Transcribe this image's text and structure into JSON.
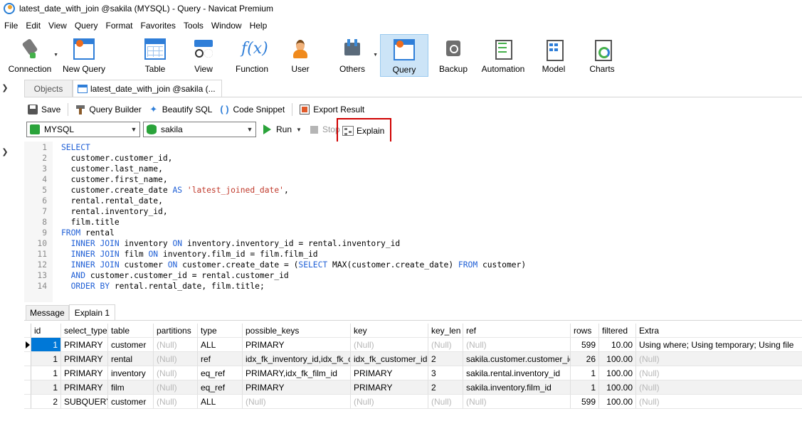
{
  "window": {
    "title": "latest_date_with_join @sakila (MYSQL) - Query - Navicat Premium"
  },
  "menu": [
    "File",
    "Edit",
    "View",
    "Query",
    "Format",
    "Favorites",
    "Tools",
    "Window",
    "Help"
  ],
  "toolbar": {
    "connection": "Connection",
    "new_query": "New Query",
    "table": "Table",
    "view": "View",
    "function": "Function",
    "function_glyph": "f(x)",
    "user": "User",
    "others": "Others",
    "query": "Query",
    "backup": "Backup",
    "automation": "Automation",
    "model": "Model",
    "charts": "Charts"
  },
  "tabs": {
    "objects": "Objects",
    "query_tab": "latest_date_with_join @sakila (..."
  },
  "query_toolbar": {
    "save": "Save",
    "query_builder": "Query Builder",
    "beautify": "Beautify SQL",
    "code_snippet": "Code Snippet",
    "export_result": "Export Result"
  },
  "connection_row": {
    "connection": "MYSQL",
    "database": "sakila",
    "run": "Run",
    "stop": "Stop",
    "explain": "Explain"
  },
  "sql_lines": [
    "SELECT",
    "  customer.customer_id,",
    "  customer.last_name,",
    "  customer.first_name,",
    "  customer.create_date AS 'latest_joined_date',",
    "  rental.rental_date,",
    "  rental.inventory_id,",
    "  film.title",
    "FROM rental",
    "  INNER JOIN inventory ON inventory.inventory_id = rental.inventory_id",
    "  INNER JOIN film ON inventory.film_id = film.film_id",
    "  INNER JOIN customer ON customer.create_date = (SELECT MAX(customer.create_date) FROM customer)",
    "  AND customer.customer_id = rental.customer_id",
    "  ORDER BY rental.rental_date, film.title;"
  ],
  "result_tabs": {
    "message": "Message",
    "explain": "Explain 1"
  },
  "result": {
    "columns": [
      "id",
      "select_type",
      "table",
      "partitions",
      "type",
      "possible_keys",
      "key",
      "key_len",
      "ref",
      "rows",
      "filtered",
      "Extra"
    ],
    "rows": [
      [
        "1",
        "PRIMARY",
        "customer",
        "(Null)",
        "ALL",
        "PRIMARY",
        "(Null)",
        "(Null)",
        "(Null)",
        "599",
        "10.00",
        "Using where; Using temporary; Using file"
      ],
      [
        "1",
        "PRIMARY",
        "rental",
        "(Null)",
        "ref",
        "idx_fk_inventory_id,idx_fk_cu",
        "idx_fk_customer_id",
        "2",
        "sakila.customer.customer_ic",
        "26",
        "100.00",
        "(Null)"
      ],
      [
        "1",
        "PRIMARY",
        "inventory",
        "(Null)",
        "eq_ref",
        "PRIMARY,idx_fk_film_id",
        "PRIMARY",
        "3",
        "sakila.rental.inventory_id",
        "1",
        "100.00",
        "(Null)"
      ],
      [
        "1",
        "PRIMARY",
        "film",
        "(Null)",
        "eq_ref",
        "PRIMARY",
        "PRIMARY",
        "2",
        "sakila.inventory.film_id",
        "1",
        "100.00",
        "(Null)"
      ],
      [
        "2",
        "SUBQUERY",
        "customer",
        "(Null)",
        "ALL",
        "(Null)",
        "(Null)",
        "(Null)",
        "(Null)",
        "599",
        "100.00",
        "(Null)"
      ]
    ]
  },
  "colors": {
    "accent": "#0078d7",
    "keyword": "#1f5fd6",
    "string": "#c0392b",
    "highlight": "#d00000"
  }
}
